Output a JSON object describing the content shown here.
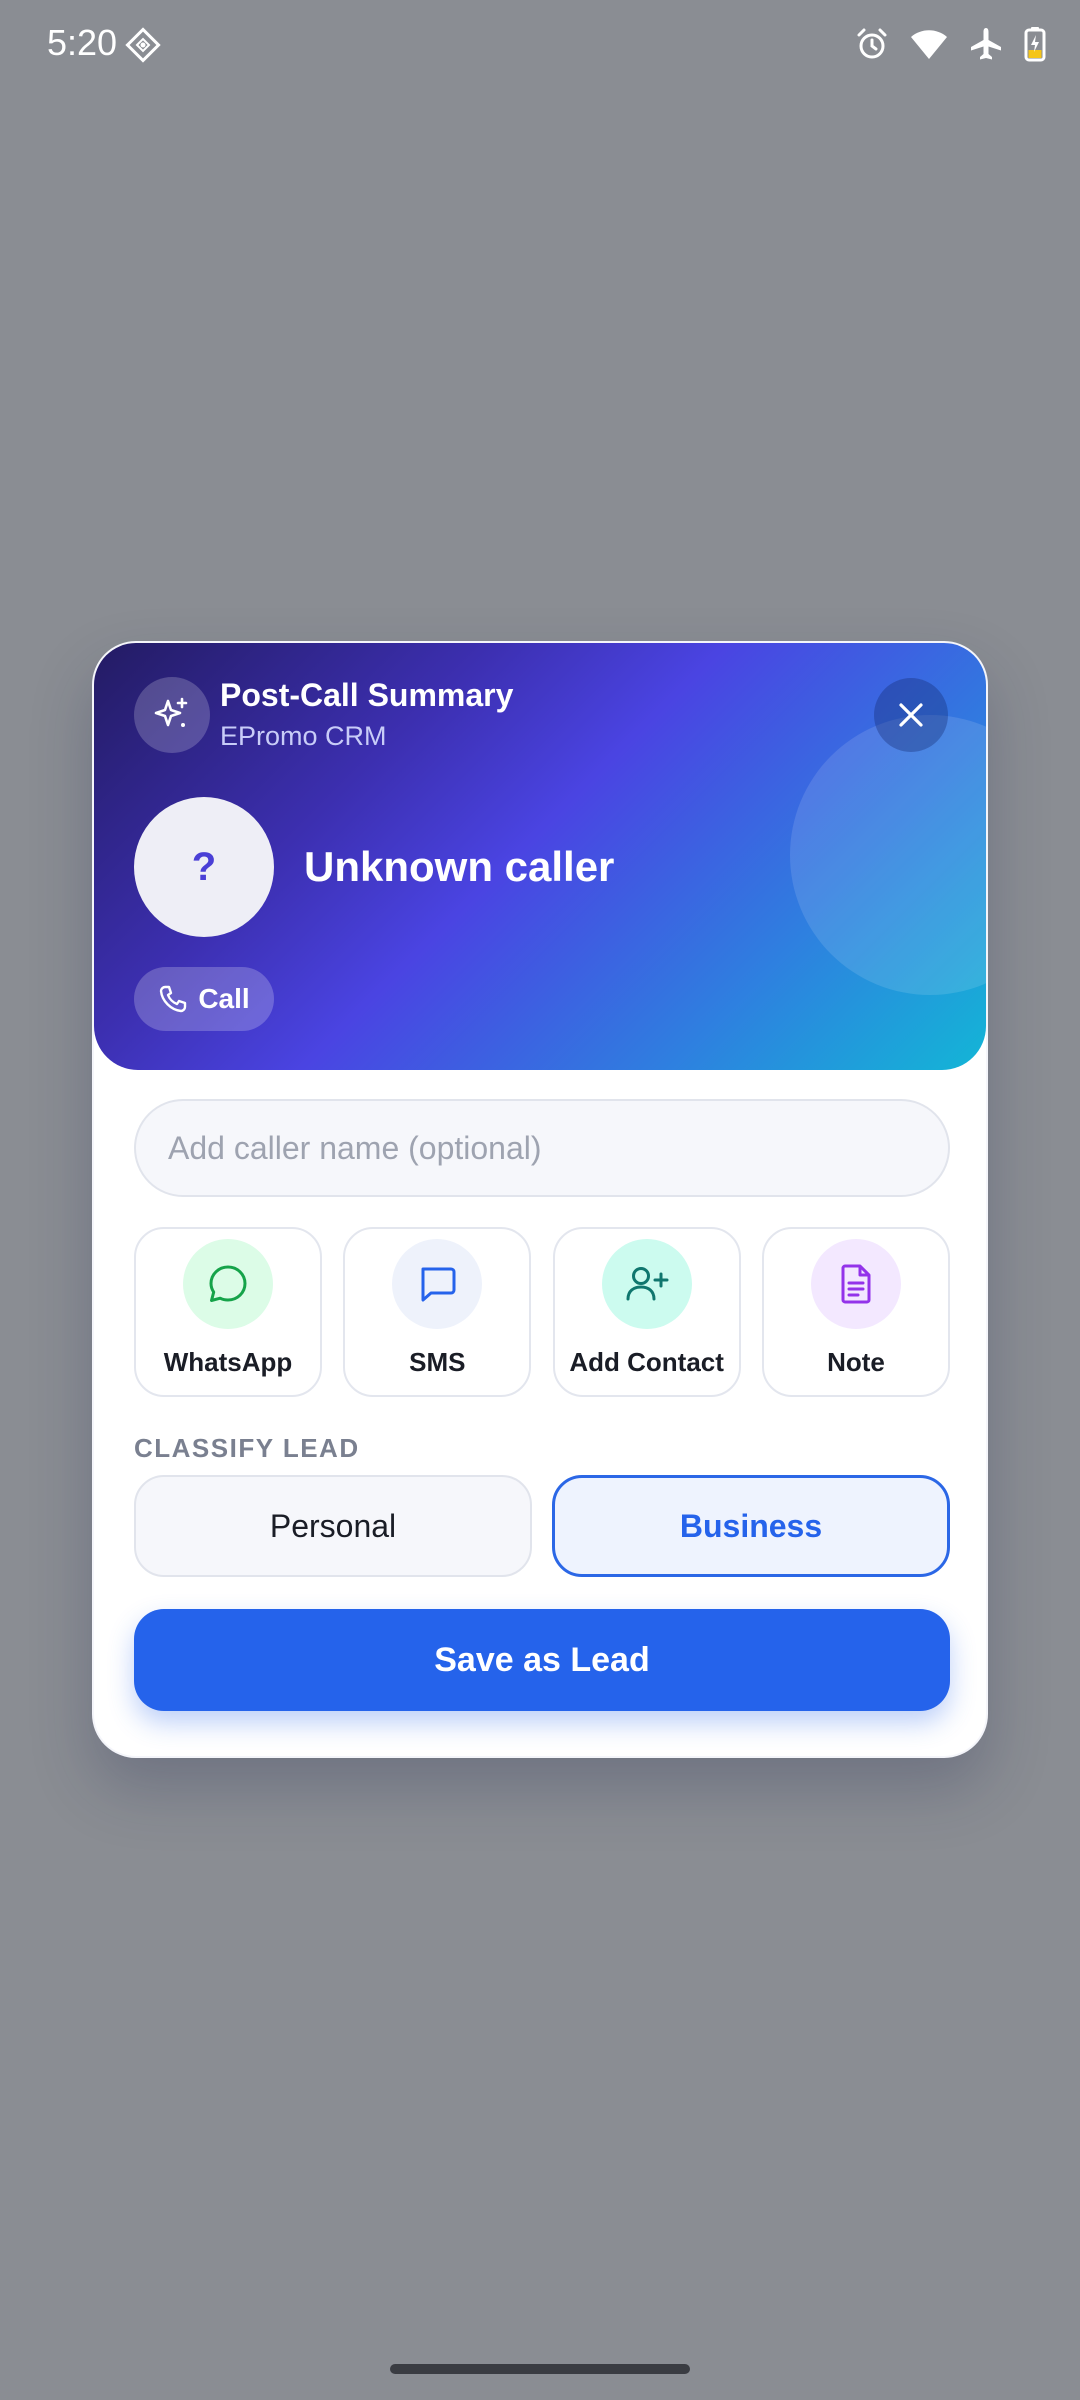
{
  "status_bar": {
    "time": "5:20",
    "icons": [
      "app-notification-icon",
      "alarm-icon",
      "wifi-icon",
      "airplane-mode-icon",
      "battery-charging-icon"
    ]
  },
  "dialog": {
    "title": "Post-Call Summary",
    "subtitle": "EPromo CRM",
    "header_icon": "sparkle-icon",
    "close_icon": "close-icon",
    "avatar_text": "?",
    "caller_name": "Unknown caller",
    "call_button_label": "Call",
    "name_input": {
      "placeholder": "Add caller name (optional)",
      "value": ""
    },
    "actions": [
      {
        "label": "WhatsApp",
        "icon": "whatsapp-icon",
        "color": "#16a34a",
        "bg": "#dcfce7"
      },
      {
        "label": "SMS",
        "icon": "sms-icon",
        "color": "#2563eb",
        "bg": "#eef2fb"
      },
      {
        "label": "Add Contact",
        "icon": "add-contact-icon",
        "color": "#0f766e",
        "bg": "#ccfbef"
      },
      {
        "label": "Note",
        "icon": "note-icon",
        "color": "#9333ea",
        "bg": "#f3e8ff"
      }
    ],
    "classify": {
      "label": "CLASSIFY LEAD",
      "options": [
        "Personal",
        "Business"
      ],
      "selected": "Business"
    },
    "save_button_label": "Save as Lead"
  },
  "colors": {
    "backdrop": "#8a8d93",
    "accent": "#2563eb"
  }
}
